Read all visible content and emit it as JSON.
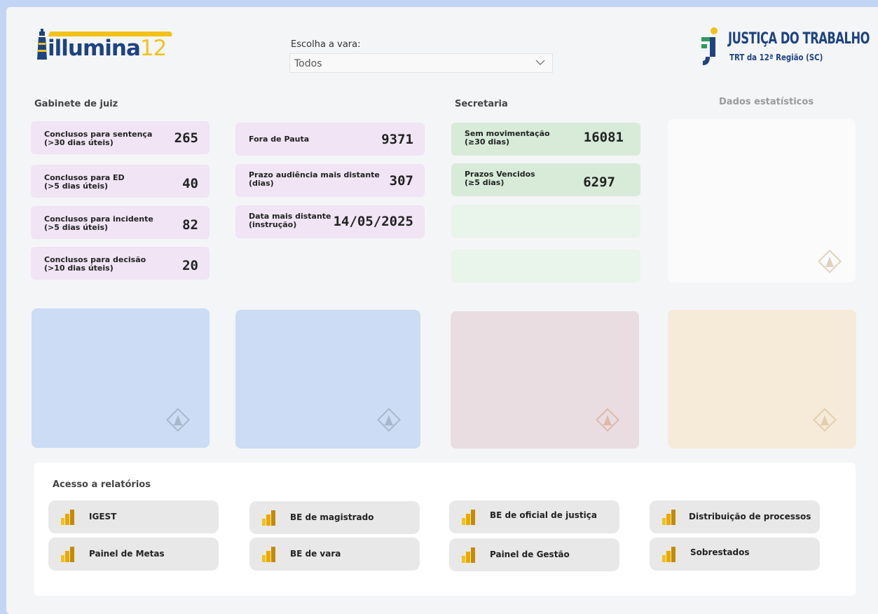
{
  "header": {
    "logo_left": {
      "word": "illumina",
      "number": "12"
    },
    "logo_right": {
      "title": "JUSTIÇA DO TRABALHO",
      "subtitle": "TRT da 12ª Região (SC)"
    },
    "vara_select": {
      "label": "Escolha a vara:",
      "value": "Todos"
    }
  },
  "sections": {
    "gabinete": "Gabinete de juiz",
    "secretaria": "Secretaria",
    "dados": "Dados estatísticos"
  },
  "gabinete_cards": [
    {
      "line1": "Conclusos para sentença",
      "line2": "(>30 dias úteis)",
      "value": "265"
    },
    {
      "line1": "Conclusos para ED",
      "line2": "(>5 dias úteis)",
      "value": "40"
    },
    {
      "line1": "Conclusos para incidente",
      "line2": "(>5 dias úteis)",
      "value": "82"
    },
    {
      "line1": "Conclusos para decisão",
      "line2": "(>10 dias úteis)",
      "value": "20"
    }
  ],
  "pauta_cards": [
    {
      "line1": "Fora de Pauta",
      "line2": "",
      "value": "9371"
    },
    {
      "line1": "Prazo audiência mais distante",
      "line2": "(dias)",
      "value": "307"
    },
    {
      "line1": "Data mais distante",
      "line2": "(instrução)",
      "value": "14/05/2025"
    }
  ],
  "secretaria_cards": [
    {
      "line1": "Sem movimentação",
      "line2": "(≥30 dias)",
      "value": "16081"
    },
    {
      "line1": "Prazos Vencidos",
      "line2": "(≥5 dias)",
      "value": "6297"
    }
  ],
  "colors": {
    "pink_card": "#f0e4f5",
    "green_card": "#d7ebd8",
    "blue_panel": "#cbdcf4",
    "mauve_panel": "#e9dde2",
    "yellow_panel": "#f6ebd8",
    "brand_blue": "#1e4380",
    "brand_yellow": "#f2c21a"
  },
  "reports": {
    "title": "Acesso a relatórios",
    "buttons": [
      {
        "label": "IGEST"
      },
      {
        "label": "BE de magistrado"
      },
      {
        "label": "BE de oficial de justiça"
      },
      {
        "label": "Distribuição de processos"
      },
      {
        "label": "Painel de Metas"
      },
      {
        "label": "BE de vara"
      },
      {
        "label": "Painel de Gestão"
      },
      {
        "label": "Sobrestados"
      }
    ]
  }
}
